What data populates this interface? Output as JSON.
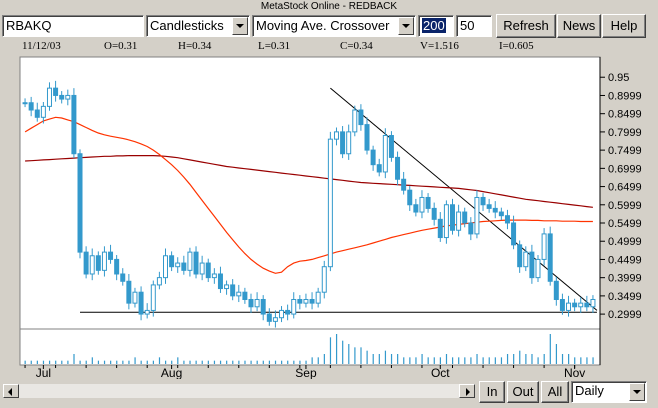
{
  "window": {
    "title": "MetaStock Online - REDBACK"
  },
  "toolbar": {
    "symbol": "RBAKQ",
    "chart_style": "Candlesticks",
    "indicator": "Moving Ave. Crossover",
    "period_long": "200",
    "period_short": "50",
    "refresh_label": "Refresh",
    "news_label": "News",
    "help_label": "Help"
  },
  "quote": {
    "date": "11/12/03",
    "open": "O=0.31",
    "high": "H=0.34",
    "low": "L=0.31",
    "close": "C=0.34",
    "volume": "V=1.516",
    "open_interest": "I=0.605"
  },
  "bottom": {
    "zoom_in_label": "In",
    "zoom_out_label": "Out",
    "all_label": "All",
    "interval": "Daily"
  },
  "colors": {
    "candle": "#3399cc",
    "ma_long": "#990000",
    "ma_short": "#ff3300",
    "trendline": "#000000",
    "volume": "#3399cc"
  },
  "chart_data": {
    "type": "candlestick",
    "x_labels": [
      "Jul",
      "Aug",
      "Sep",
      "Oct",
      "Nov"
    ],
    "y_ticks": [
      "0.95",
      "0.8999",
      "0.8499",
      "0.7999",
      "0.7499",
      "0.6999",
      "0.6499",
      "0.5999",
      "0.5499",
      "0.4999",
      "0.4499",
      "0.3999",
      "0.3499",
      "0.2999"
    ],
    "ylim": [
      0.27,
      1.0
    ],
    "close": [
      0.88,
      0.86,
      0.84,
      0.87,
      0.92,
      0.9,
      0.89,
      0.9,
      0.74,
      0.47,
      0.41,
      0.46,
      0.42,
      0.47,
      0.45,
      0.41,
      0.39,
      0.33,
      0.36,
      0.3,
      0.31,
      0.38,
      0.4,
      0.46,
      0.43,
      0.44,
      0.42,
      0.47,
      0.41,
      0.44,
      0.4,
      0.41,
      0.37,
      0.38,
      0.35,
      0.36,
      0.34,
      0.32,
      0.34,
      0.3,
      0.28,
      0.29,
      0.31,
      0.3,
      0.34,
      0.33,
      0.34,
      0.33,
      0.36,
      0.43,
      0.78,
      0.8,
      0.74,
      0.8,
      0.86,
      0.82,
      0.75,
      0.71,
      0.69,
      0.79,
      0.73,
      0.67,
      0.64,
      0.6,
      0.58,
      0.62,
      0.59,
      0.56,
      0.51,
      0.6,
      0.53,
      0.58,
      0.55,
      0.52,
      0.62,
      0.6,
      0.59,
      0.58,
      0.57,
      0.55,
      0.49,
      0.43,
      0.47,
      0.4,
      0.45,
      0.52,
      0.39,
      0.34,
      0.31,
      0.33,
      0.32,
      0.33,
      0.32,
      0.34
    ],
    "ma_long": [
      0.72,
      0.721,
      0.722,
      0.723,
      0.724,
      0.725,
      0.726,
      0.727,
      0.728,
      0.729,
      0.73,
      0.731,
      0.732,
      0.733,
      0.733,
      0.734,
      0.734,
      0.735,
      0.735,
      0.735,
      0.735,
      0.735,
      0.734,
      0.733,
      0.731,
      0.729,
      0.726,
      0.723,
      0.72,
      0.717,
      0.714,
      0.711,
      0.708,
      0.705,
      0.703,
      0.701,
      0.699,
      0.697,
      0.695,
      0.693,
      0.691,
      0.689,
      0.687,
      0.685,
      0.683,
      0.681,
      0.679,
      0.677,
      0.675,
      0.673,
      0.671,
      0.669,
      0.667,
      0.665,
      0.663,
      0.661,
      0.66,
      0.659,
      0.658,
      0.657,
      0.656,
      0.655,
      0.654,
      0.653,
      0.652,
      0.651,
      0.65,
      0.649,
      0.648,
      0.647,
      0.646,
      0.645,
      0.643,
      0.641,
      0.639,
      0.636,
      0.633,
      0.63,
      0.627,
      0.624,
      0.621,
      0.618,
      0.615,
      0.613,
      0.611,
      0.609,
      0.607,
      0.605,
      0.603,
      0.601,
      0.599,
      0.597,
      0.595,
      0.593
    ],
    "ma_short": [
      0.8,
      0.81,
      0.82,
      0.83,
      0.835,
      0.84,
      0.838,
      0.833,
      0.828,
      0.82,
      0.812,
      0.804,
      0.797,
      0.792,
      0.788,
      0.785,
      0.782,
      0.778,
      0.773,
      0.767,
      0.76,
      0.75,
      0.738,
      0.724,
      0.71,
      0.694,
      0.676,
      0.656,
      0.634,
      0.612,
      0.59,
      0.568,
      0.546,
      0.524,
      0.504,
      0.484,
      0.466,
      0.45,
      0.437,
      0.426,
      0.418,
      0.412,
      0.415,
      0.43,
      0.44,
      0.445,
      0.447,
      0.45,
      0.455,
      0.46,
      0.465,
      0.47,
      0.474,
      0.478,
      0.482,
      0.486,
      0.49,
      0.495,
      0.5,
      0.505,
      0.51,
      0.514,
      0.518,
      0.522,
      0.526,
      0.53,
      0.533,
      0.536,
      0.539,
      0.542,
      0.544,
      0.546,
      0.548,
      0.55,
      0.552,
      0.554,
      0.555,
      0.556,
      0.557,
      0.558,
      0.558,
      0.558,
      0.558,
      0.557,
      0.557,
      0.556,
      0.556,
      0.556,
      0.555,
      0.555,
      0.555,
      0.554,
      0.554,
      0.554
    ],
    "volume": [
      1,
      1,
      1,
      1,
      1,
      1,
      1,
      1,
      3,
      1,
      1,
      2,
      1,
      1,
      1,
      1,
      1,
      1,
      2,
      1,
      1,
      1,
      2,
      1,
      1,
      2,
      1,
      1,
      1,
      1,
      1,
      1,
      1,
      1,
      1,
      1,
      1,
      1,
      1,
      1,
      1,
      1,
      1,
      1,
      1,
      1,
      1,
      2,
      2,
      3,
      8,
      9,
      7,
      6,
      5,
      5,
      4,
      3,
      3,
      4,
      3,
      3,
      2,
      2,
      2,
      3,
      2,
      2,
      2,
      3,
      2,
      2,
      2,
      2,
      3,
      2,
      2,
      2,
      2,
      3,
      3,
      4,
      3,
      3,
      2,
      3,
      9,
      6,
      3,
      3,
      2,
      2,
      2,
      2
    ],
    "trendline_resistance": [
      [
        50,
        0.92
      ],
      [
        93,
        0.31
      ]
    ],
    "trendline_support": [
      [
        9,
        0.305
      ],
      [
        93,
        0.305
      ]
    ]
  }
}
